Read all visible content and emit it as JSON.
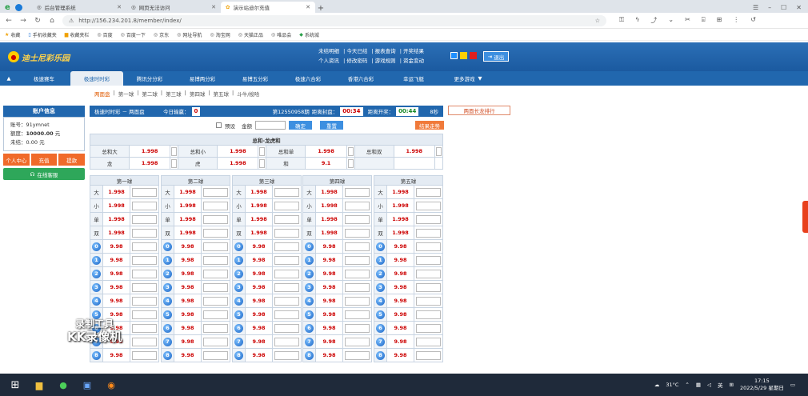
{
  "browser": {
    "tabs": [
      {
        "label": "后台管理系统"
      },
      {
        "label": "网页无法访问"
      },
      {
        "label": "演示站迪尔充值"
      }
    ],
    "url": "http://156.234.201.8/member/index/",
    "bookmarks": [
      "收藏",
      "手机收藏夹",
      "收藏夹栏",
      "百度",
      "百度一下",
      "京东",
      "网址导航",
      "淘宝网",
      "天猫正品",
      "唯品会",
      "系统城"
    ]
  },
  "header": {
    "logo_text": "迪士尼彩乐园",
    "links_row1": [
      "未结明细",
      "今天已结",
      "报表查询",
      "开奖结果"
    ],
    "links_row2": [
      "个人资讯",
      "修改密码",
      "游戏规则",
      "资金变动"
    ],
    "logout_label": "退出",
    "swatch_colors": [
      "#1e90ff",
      "#ffd000",
      "#e02020"
    ]
  },
  "nav": {
    "items": [
      "极速赛车",
      "极速时时彩",
      "腾讯分分彩",
      "易博两分彩",
      "易博五分彩",
      "极速六合彩",
      "香港六合彩",
      "幸运飞艇",
      "更多游戏"
    ],
    "active_index": 1
  },
  "subnav": [
    "两面盘",
    "第一球",
    "第二球",
    "第三球",
    "第四球",
    "第五球",
    "斗牛/梭哈"
  ],
  "account": {
    "title": "账户信息",
    "account_label": "账号：",
    "account_value": "91ymnet",
    "credit_label": "额度：",
    "credit_value": "10000.00",
    "credit_unit": "元",
    "unsettled_label": "未结：",
    "unsettled_value": "0.00",
    "unsettled_unit": "元",
    "buttons": [
      "个人中心",
      "充值",
      "提款"
    ],
    "service_label": "在线客服"
  },
  "info": {
    "game": "极速时时彩 － 两面盘",
    "today_label": "今日输赢：",
    "today_value": "0",
    "period": "第12550958期",
    "close_label": "距离封盘：",
    "close_value": "00:34",
    "open_label": "距离开奖：",
    "open_value": "00:44",
    "seconds": "8秒",
    "rank_label": "两面长龙排行"
  },
  "bet": {
    "preset_label": "预设",
    "amount_label": "金额",
    "confirm_label": "确定",
    "reset_label": "重置",
    "trend_label": "结果走势"
  },
  "sum_table": {
    "title": "总和-龙虎和",
    "row1": [
      {
        "label": "总和大",
        "odds": "1.998"
      },
      {
        "label": "总和小",
        "odds": "1.998"
      },
      {
        "label": "总和单",
        "odds": "1.998"
      },
      {
        "label": "总和双",
        "odds": "1.998"
      }
    ],
    "row2": [
      {
        "label": "龙",
        "odds": "1.998"
      },
      {
        "label": "虎",
        "odds": "1.998"
      },
      {
        "label": "和",
        "odds": "9.1"
      }
    ]
  },
  "balls": {
    "headers": [
      "第一球",
      "第二球",
      "第三球",
      "第四球",
      "第五球"
    ],
    "text_rows": [
      {
        "label": "大",
        "odds": "1.998"
      },
      {
        "label": "小",
        "odds": "1.998"
      },
      {
        "label": "单",
        "odds": "1.998"
      },
      {
        "label": "双",
        "odds": "1.998"
      }
    ],
    "number_rows": [
      {
        "label": "0",
        "odds": "9.98"
      },
      {
        "label": "1",
        "odds": "9.98"
      },
      {
        "label": "2",
        "odds": "9.98"
      },
      {
        "label": "3",
        "odds": "9.98"
      },
      {
        "label": "4",
        "odds": "9.98"
      },
      {
        "label": "5",
        "odds": "9.98"
      },
      {
        "label": "6",
        "odds": "9.98"
      },
      {
        "label": "7",
        "odds": "9.98"
      },
      {
        "label": "8",
        "odds": "9.98"
      }
    ]
  },
  "watermark": {
    "line1": "录制工具",
    "line2": "KK录像机"
  },
  "taskbar": {
    "temp": "31°C",
    "ime": "英",
    "time": "17:15",
    "date": "2022/5/29 星期日"
  }
}
